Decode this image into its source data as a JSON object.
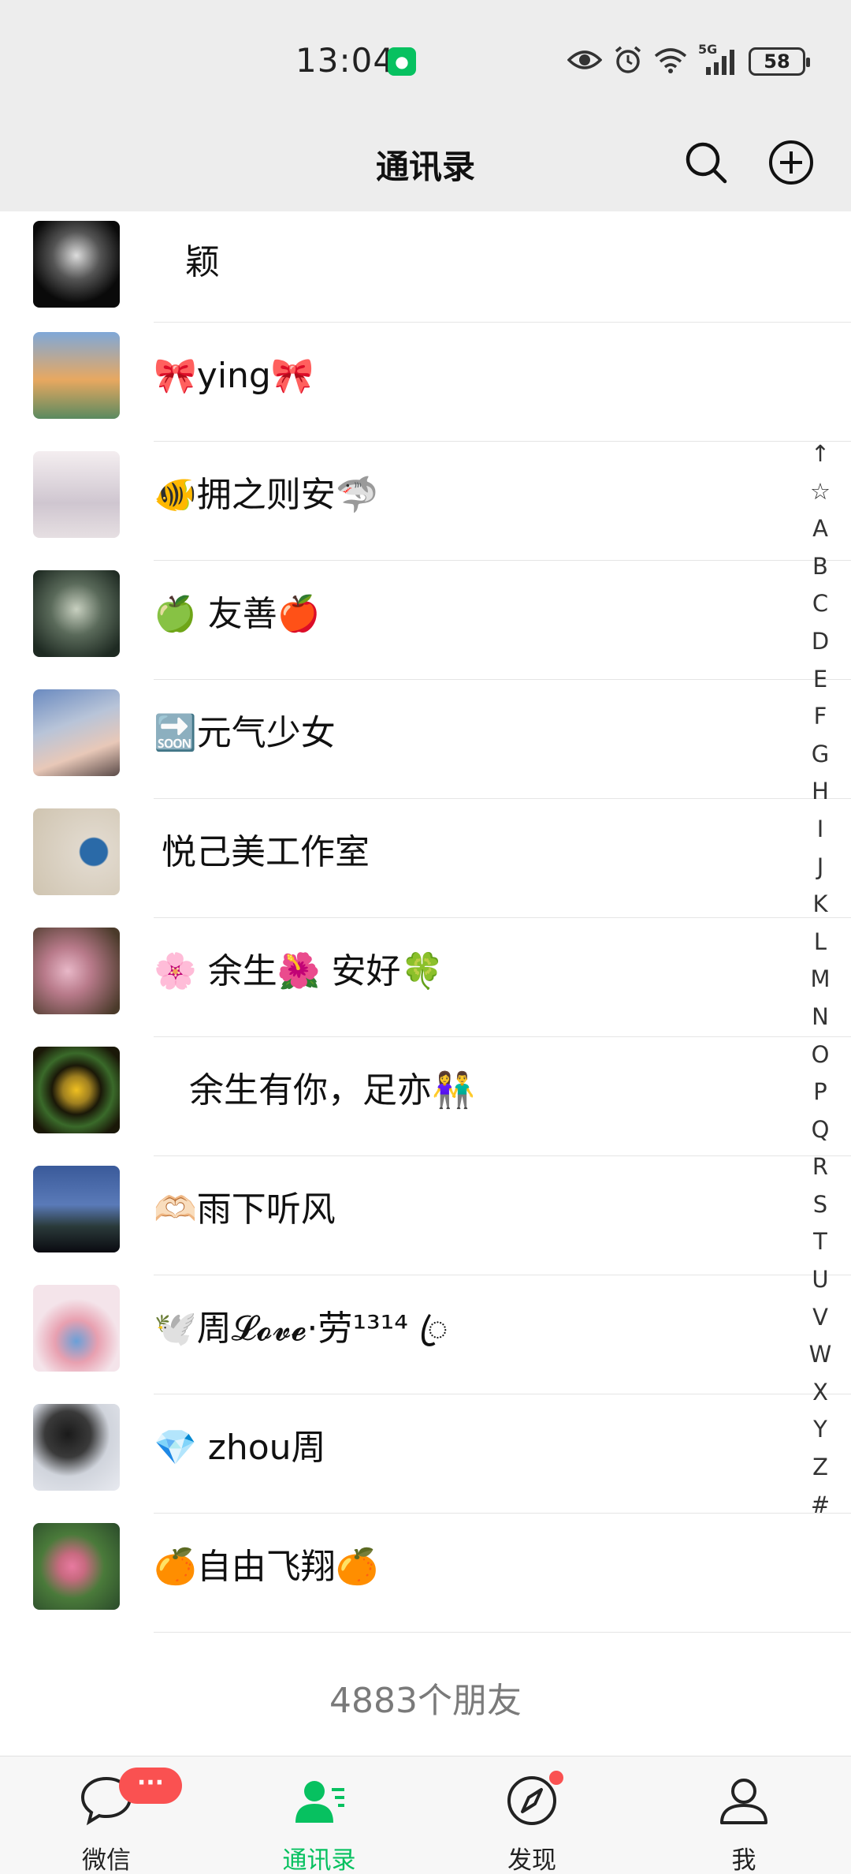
{
  "status_bar": {
    "time": "13:04",
    "notification_icon": "wechat-icon",
    "icons": [
      "eye-icon",
      "alarm-icon",
      "wifi-icon",
      "5g-signal-icon"
    ],
    "network_label": "5G",
    "battery": "58"
  },
  "header": {
    "title": "通讯录",
    "search_icon": "search-icon",
    "add_icon": "add-circle-icon"
  },
  "contacts": [
    {
      "name": "颖",
      "avatar_color": "#2a2a2a"
    },
    {
      "name": "🎀ying🎀",
      "avatar_color": "#d98a3a"
    },
    {
      "name": "🐠拥之则安🦈",
      "avatar_color": "#e8e0e4"
    },
    {
      "name": "🍏 友善🍎",
      "avatar_color": "#4a5a4a"
    },
    {
      "name": "🔜元气少女",
      "avatar_color": "#8a9ab8"
    },
    {
      "name": "悦己美工作室",
      "avatar_color": "#d8d0c4"
    },
    {
      "name": "🌸 余生🌺 安好🍀",
      "avatar_color": "#9a6a7a"
    },
    {
      "name": "余生有你，足亦👫",
      "avatar_color": "#2a2410"
    },
    {
      "name": "🫶🏻雨下听风",
      "avatar_color": "#2a3a6a"
    },
    {
      "name": "🕊️周𝓛𝓸𝓿𝓮·劳¹³¹⁴ ꦿ",
      "avatar_color": "#e8d8e0"
    },
    {
      "name": "💎 zhou周",
      "avatar_color": "#c8ccd4"
    },
    {
      "name": "🍊自由飞翔🍊",
      "avatar_color": "#5a7a4a"
    }
  ],
  "friend_count": "4883个朋友",
  "index_bar": [
    "↑",
    "☆",
    "A",
    "B",
    "C",
    "D",
    "E",
    "F",
    "G",
    "H",
    "I",
    "J",
    "K",
    "L",
    "M",
    "N",
    "O",
    "P",
    "Q",
    "R",
    "S",
    "T",
    "U",
    "V",
    "W",
    "X",
    "Y",
    "Z",
    "#"
  ],
  "tabbar": {
    "tabs": [
      {
        "label": "微信",
        "icon": "chat-bubble-icon",
        "badge": "···"
      },
      {
        "label": "通讯录",
        "icon": "contacts-icon",
        "active": true
      },
      {
        "label": "发现",
        "icon": "compass-icon",
        "dot": true
      },
      {
        "label": "我",
        "icon": "person-icon"
      }
    ]
  },
  "colors": {
    "accent": "#07c160",
    "badge": "#fa5151",
    "header_bg": "#ededed"
  }
}
